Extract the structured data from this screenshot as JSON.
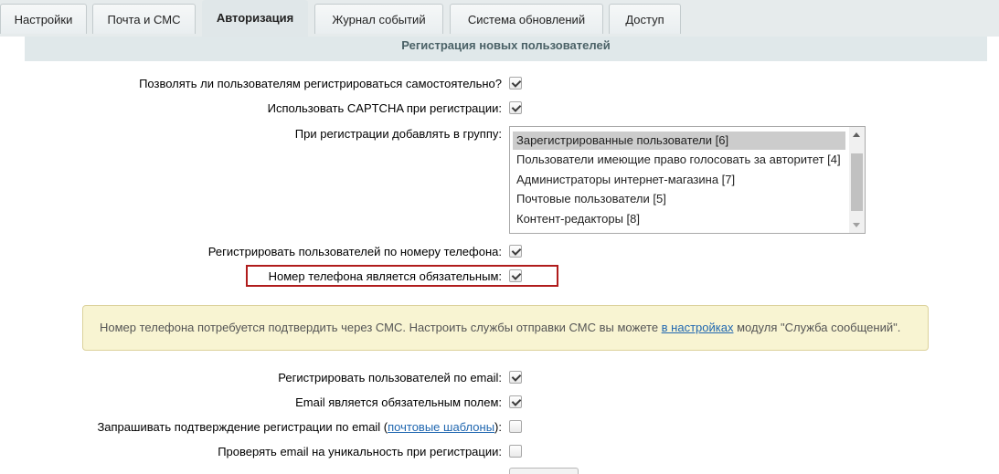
{
  "tabs": [
    {
      "label": "Настройки"
    },
    {
      "label": "Почта и СМС"
    },
    {
      "label": "Авторизация"
    },
    {
      "label": "Журнал событий"
    },
    {
      "label": "Система обновлений"
    },
    {
      "label": "Доступ"
    }
  ],
  "section_title": "Регистрация новых пользователей",
  "rows": {
    "allow_self_register": "Позволять ли пользователям регистрироваться самостоятельно?",
    "use_captcha": "Использовать CAPTCHA при регистрации:",
    "default_group": "При регистрации добавлять в группу:",
    "register_by_phone": "Регистрировать пользователей по номеру телефона:",
    "phone_required": "Номер телефона является обязательным:",
    "register_by_email": "Регистрировать пользователей по email:",
    "email_required": "Email является обязательным полем:",
    "confirm_email_prefix": "Запрашивать подтверждение регистрации по email (",
    "confirm_email_link": "почтовые шаблоны",
    "confirm_email_suffix": "):",
    "unique_email": "Проверять email на уникальность при регистрации:"
  },
  "group_list": [
    "Зарегистрированные пользователи [6]",
    "Пользователи имеющие право голосовать за авторитет [4]",
    "Администраторы интернет-магазина [7]",
    "Почтовые пользователи [5]",
    "Контент-редакторы [8]"
  ],
  "notice": {
    "prefix": "Номер телефона потребуется подтвердить через СМС. Настроить службы отправки СМС вы можете ",
    "link": "в настройках",
    "suffix": " модуля \"Служба сообщений\"."
  },
  "checkbox_states": {
    "allow_self_register": true,
    "use_captcha": true,
    "register_by_phone": true,
    "phone_required": true,
    "register_by_email": true,
    "email_required": true,
    "confirm_email": false,
    "unique_email": false
  },
  "colors": {
    "highlight_border": "#b01c1c",
    "notice_bg": "#f8f4d2",
    "link": "#2067b0"
  }
}
